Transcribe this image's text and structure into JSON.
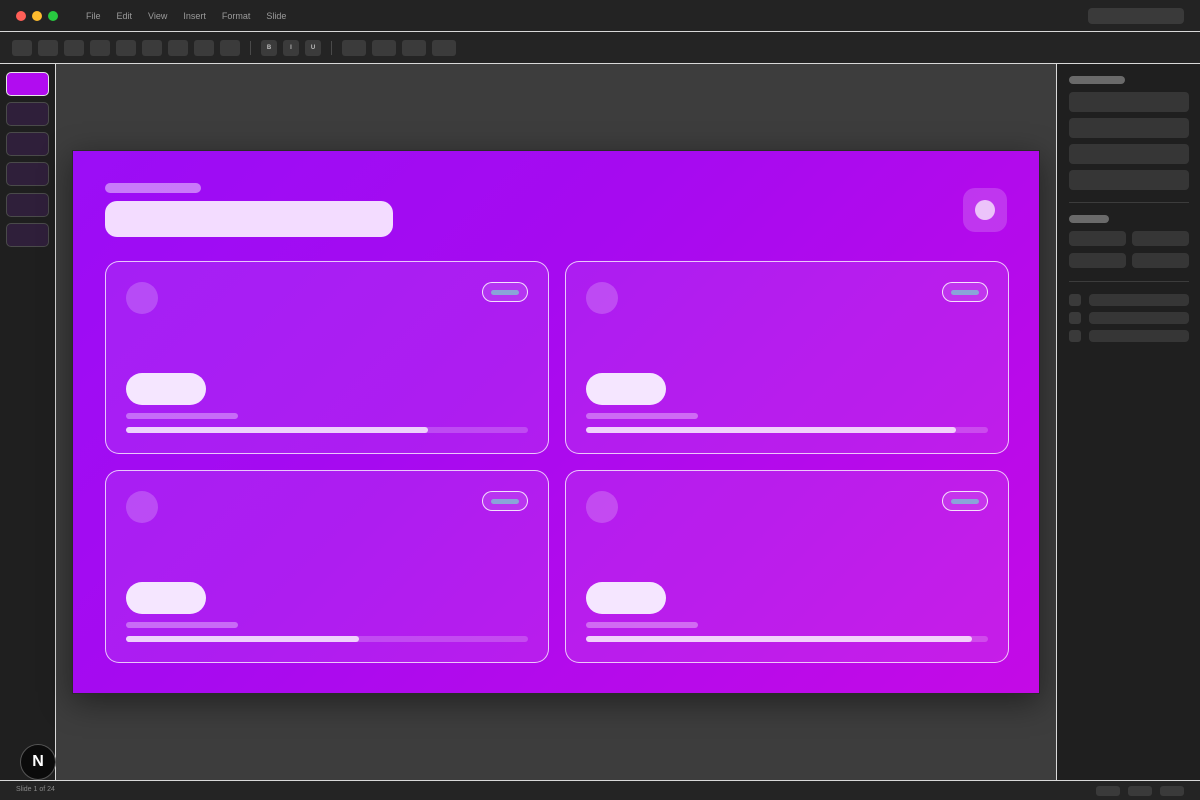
{
  "menu": [
    "File",
    "Edit",
    "View",
    "Insert",
    "Format",
    "Slide"
  ],
  "toolbar": {
    "format_buttons": [
      "B",
      "I",
      "U"
    ]
  },
  "cards": [
    {
      "progress": 0.75
    },
    {
      "progress": 0.92
    },
    {
      "progress": 0.58
    },
    {
      "progress": 0.96
    }
  ],
  "status": {
    "slide_text": "Slide 1 of 24"
  },
  "fab": {
    "label": "N"
  },
  "colors": {
    "slide_gradient_start": "#9b0df6",
    "slide_gradient_end": "#c40ae6",
    "accent": "#b10cf0"
  }
}
